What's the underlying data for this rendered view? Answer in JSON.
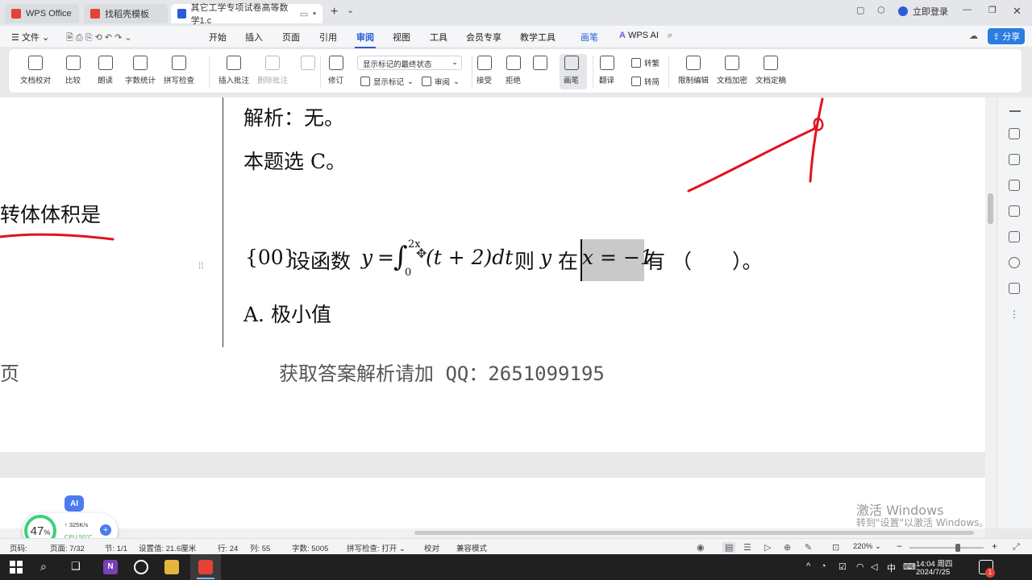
{
  "tabs": [
    {
      "label": "WPS Office",
      "color": "#e34234"
    },
    {
      "label": "找稻壳模板",
      "color": "#e34234"
    },
    {
      "label": "其它工学专项试卷高等数学1.c",
      "color": "#2a5dd6"
    }
  ],
  "titlebar": {
    "login": "立即登录"
  },
  "menu": {
    "file": "文件",
    "items": [
      "开始",
      "插入",
      "页面",
      "引用",
      "审阅",
      "视图",
      "工具",
      "会员专享",
      "教学工具",
      "画笔"
    ],
    "active": "审阅",
    "ai": "WPS AI",
    "share": "分享"
  },
  "ribbon": {
    "doc_proof": "文档校对",
    "compare": "比较",
    "read_aloud": "朗读",
    "word_count": "字数统计",
    "spell_check": "拼写检查",
    "insert_comment": "插入批注",
    "delete_comment": "删除批注",
    "revise": "修订",
    "markup_select": "显示标记的最终状态",
    "show_markup": "显示标记",
    "review": "审阅",
    "accept": "接受",
    "reject": "拒绝",
    "pen": "画笔",
    "translate": "翻译",
    "to_traditional": "转繁",
    "to_simplified": "转简",
    "restrict_edit": "限制编辑",
    "doc_encrypt": "文档加密",
    "doc_finalize": "文档定稿"
  },
  "document": {
    "analysis": "解析：无。",
    "answer": "本题选 C。",
    "left_fragment": "转体体积是",
    "question_num": "{00}",
    "question_pre": "设函数",
    "formula_y": "y",
    "formula_eq": "=",
    "integral_upper": "2x",
    "integral_lower": "0",
    "integrand": "(t + 2)dt",
    "question_mid": "则",
    "question_y": "y",
    "question_at": "在",
    "highlight": "x = −1",
    "question_post": "有 （　　）。",
    "option_a": "A. 极小值",
    "footer_left": "页",
    "footer": "获取答案解析请加 QQ：2651099195"
  },
  "statusbar": {
    "page": "页码: ",
    "pages": "页面: 7/32",
    "section": "节: 1/1",
    "setting": "设置值: 21.6厘米",
    "row": "行: 24",
    "col": "列: 55",
    "words": "字数: 5005",
    "spell": "拼写检查: 打开",
    "proof": "校对",
    "compat": "兼容模式",
    "zoom": "220%"
  },
  "widget": {
    "ai": "AI",
    "cpu_percent": "47",
    "percent_sign": "%",
    "net_speed": "325K/s",
    "cpu_temp": "CPU 50°C"
  },
  "watermark": {
    "line1": "激活 Windows",
    "line2": "转到\"设置\"以激活 Windows。"
  },
  "taskbar": {
    "time": "14:04 周四",
    "date": "2024/7/25",
    "ime": "中",
    "notif_count": "1"
  },
  "colors": {
    "accent": "#2a5dd6",
    "pen_red": "#e0141e",
    "wps_red": "#e34234"
  }
}
